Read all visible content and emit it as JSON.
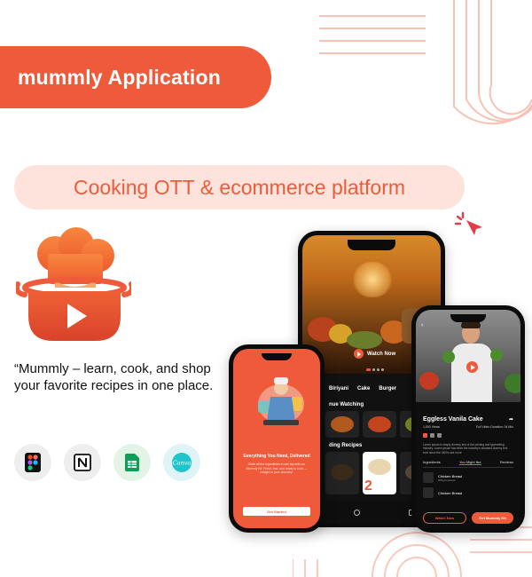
{
  "banner": {
    "title": "mummly Application",
    "subtitle": "Cooking OTT & ecommerce platform",
    "quote": "“Mummly – learn, cook, and shop your favorite recipes in one place.",
    "accent_color": "#ef5b3a",
    "soft_accent_color": "#fde3dc"
  },
  "tools": [
    {
      "name": "Figma",
      "icon": "figma-icon"
    },
    {
      "name": "Notion",
      "icon": "notion-icon"
    },
    {
      "name": "Google Sheets",
      "icon": "sheets-icon"
    },
    {
      "name": "Canva",
      "icon": "canva-icon",
      "label": "Canva"
    }
  ],
  "phone_home": {
    "watch_now": "Watch Now",
    "categories": [
      "Biriyani",
      "Cake",
      "Burger"
    ],
    "continue_watching": "nue Watching",
    "trending": "ding Recipes",
    "badge": "2"
  },
  "phone_onboarding": {
    "status": "9:41",
    "heading": "Everything You Need, Delivered",
    "body": "Order all the ingredients in one tap with our Mummly Kit. Fresh, fast, and ready to cook — straight to your doorstep.",
    "cta": "Get Started"
  },
  "phone_detail": {
    "title": "Eggless Vanila Cake",
    "views": "1,500 Views",
    "duration": "Full Video Duration: 04 Min",
    "description": "Lorem ipsum is simply dummy text of the printing and typesetting industry. Lorem ipsum has been the industry's standard dummy text ever since the 1500s see more",
    "tabs": [
      "Ingredients",
      "You Might like",
      "Reviews"
    ],
    "ingredients": [
      {
        "name": "Chicken Breast",
        "qty": "500g boneless"
      },
      {
        "name": "Chicken Breast",
        "qty": ""
      }
    ],
    "watch_btn": "Watch Now",
    "buy_btn": "Get Mummly Kit"
  }
}
